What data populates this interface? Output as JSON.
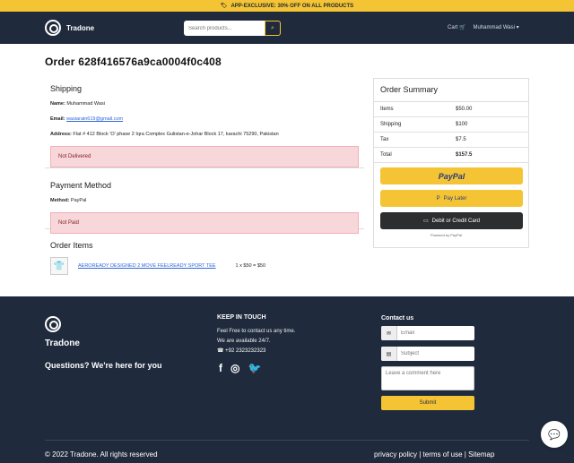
{
  "topbar": {
    "text": "APP-EXCLUSIVE: 30% OFF ON ALL PRODUCTS"
  },
  "header": {
    "brand": "Tradone",
    "search_placeholder": "Search products...",
    "cart": "Cart",
    "user": "Muhammad Wasi"
  },
  "order": {
    "title": "Order 628f416576a9ca0004f0c408",
    "shipping": {
      "heading": "Shipping",
      "name_label": "Name:",
      "name": "Muhammad Wasi",
      "email_label": "Email:",
      "email": "wasiarain619@gmail.com",
      "address_label": "Address:",
      "address": "Flat # 412 Block 'O' phase 2 Iqra Complex Gulistan-e-Johar Block 17, karachi 75290, Pakistan",
      "status": "Not Delivered"
    },
    "payment": {
      "heading": "Payment Method",
      "method_label": "Method:",
      "method": "PayPal",
      "status": "Not Paid"
    },
    "items": {
      "heading": "Order Items",
      "product": "AEROREADY DESIGNED 2 MOVE FEELREADY SPORT TEE",
      "qty_price": "1 x $50 = $50"
    }
  },
  "summary": {
    "heading": "Order Summary",
    "rows": [
      {
        "label": "Items",
        "value": "$50.00"
      },
      {
        "label": "Shipping",
        "value": "$100"
      },
      {
        "label": "Tax",
        "value": "$7.5"
      },
      {
        "label": "Total",
        "value": "$157.5"
      }
    ],
    "paypal": "PayPal",
    "pay_later": "Pay Later",
    "card": "Debit or Credit Card",
    "powered": "Powered by PayPal"
  },
  "footer": {
    "brand": "Tradone",
    "tagline": "Questions? We're here for you",
    "keep_title": "KEEP IN TOUCH",
    "keep_text_1": "Feel Free to contact us any time.",
    "keep_text_2": "We are available 24/7.",
    "phone": "+92 2323232323",
    "contact_title": "Contact us",
    "email_placeholder": "Email",
    "subject_placeholder": "Subject",
    "comment_placeholder": "Leave a comment here",
    "submit": "Submit",
    "copyright": "© 2022 Tradone. All rights reserved",
    "links": "privacy policy | terms of use | Sitemap"
  },
  "colors": {
    "accent": "#f5c434",
    "navy": "#1f2a3c",
    "alert": "#f8d7da",
    "link": "#2f67d8"
  },
  "icons": [
    "tag-icon",
    "search-icon",
    "cart-icon",
    "chevron-down-icon",
    "phone-icon",
    "facebook-icon",
    "instagram-icon",
    "twitter-icon",
    "chat-icon"
  ]
}
